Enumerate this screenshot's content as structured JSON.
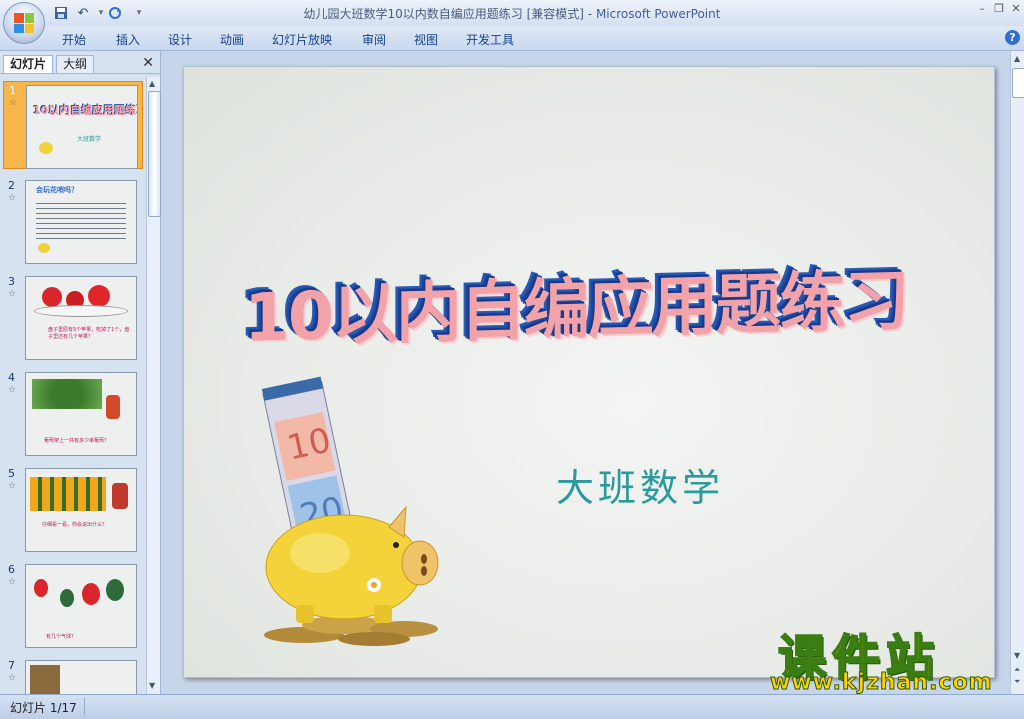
{
  "window": {
    "title_doc": "幼儿园大班数学10以内数自编应用题练习 [兼容模式] - ",
    "title_app": "Microsoft PowerPoint"
  },
  "ribbon": {
    "tabs": [
      "开始",
      "插入",
      "设计",
      "动画",
      "幻灯片放映",
      "审阅",
      "视图",
      "开发工具"
    ]
  },
  "left_pane": {
    "tabs": [
      "幻灯片",
      "大纲"
    ],
    "slides": [
      {
        "num": "1",
        "thumb_title": "10以内自编应用题练习",
        "thumb_sub": "大班数学",
        "selected": true
      },
      {
        "num": "2",
        "thumb_title": "会玩花哨吗？"
      },
      {
        "num": "3",
        "thumb_caption": "盘子里原有5个苹果，吃掉了1个，盘子里还有几个苹果？"
      },
      {
        "num": "4",
        "thumb_caption": "葡萄架上一共有多少串葡萄？"
      },
      {
        "num": "5",
        "thumb_caption": "仔细看一看，你会说出什么？"
      },
      {
        "num": "6",
        "thumb_caption": "有几个气球？"
      },
      {
        "num": "7"
      }
    ]
  },
  "slide": {
    "title": "10以内自编应用题练习",
    "subtitle": "大班数学"
  },
  "status": {
    "slide_indicator": "幻灯片 1/17"
  },
  "watermark": {
    "brand": "课件站",
    "url": "www.kjzhan.com"
  },
  "colors": {
    "title_face": "#f2a2a9",
    "title_extrude": "#1f4aa0",
    "subtitle": "#2a9a9c",
    "selected_thumb": "#f8b64a"
  }
}
